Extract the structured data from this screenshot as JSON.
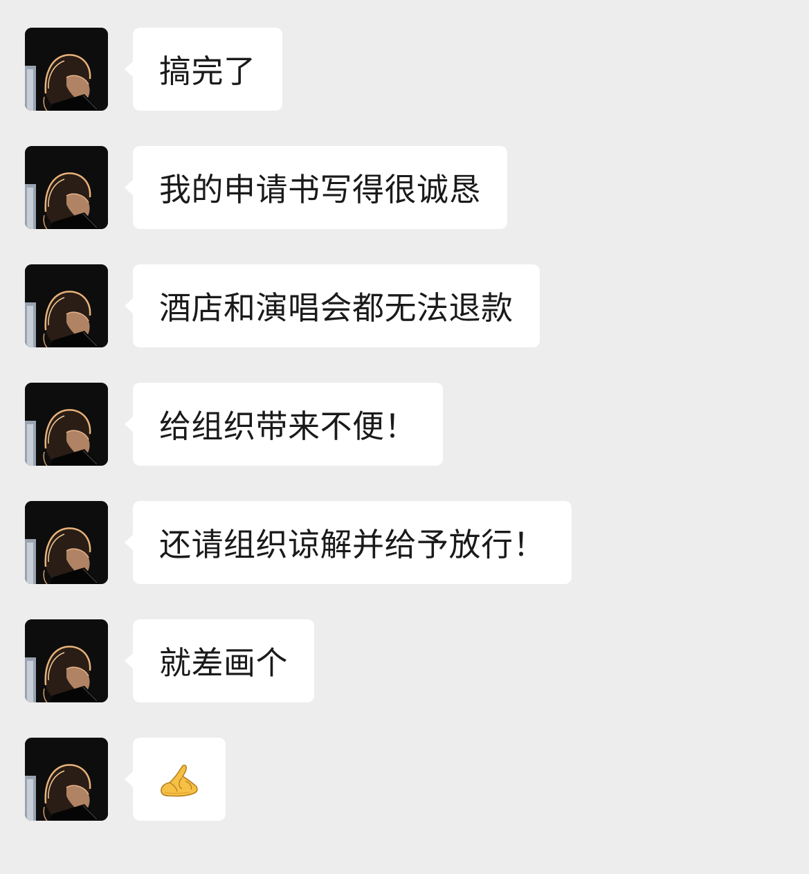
{
  "chat": {
    "messages": [
      {
        "sender": "other",
        "avatar_icon": "user-avatar-icon",
        "text": "搞完了"
      },
      {
        "sender": "other",
        "avatar_icon": "user-avatar-icon",
        "text": "我的申请书写得很诚恳"
      },
      {
        "sender": "other",
        "avatar_icon": "user-avatar-icon",
        "text": "酒店和演唱会都无法退款"
      },
      {
        "sender": "other",
        "avatar_icon": "user-avatar-icon",
        "text": "给组织带来不便！"
      },
      {
        "sender": "other",
        "avatar_icon": "user-avatar-icon",
        "text": "还请组织谅解并给予放行！"
      },
      {
        "sender": "other",
        "avatar_icon": "user-avatar-icon",
        "text": "就差画个"
      },
      {
        "sender": "other",
        "avatar_icon": "user-avatar-icon",
        "text": "",
        "emoji": "folded-hands-emoji-icon"
      }
    ]
  },
  "colors": {
    "background": "#ededed",
    "bubble": "#ffffff",
    "text": "#1a1a1a",
    "emoji": "#f5c044"
  }
}
